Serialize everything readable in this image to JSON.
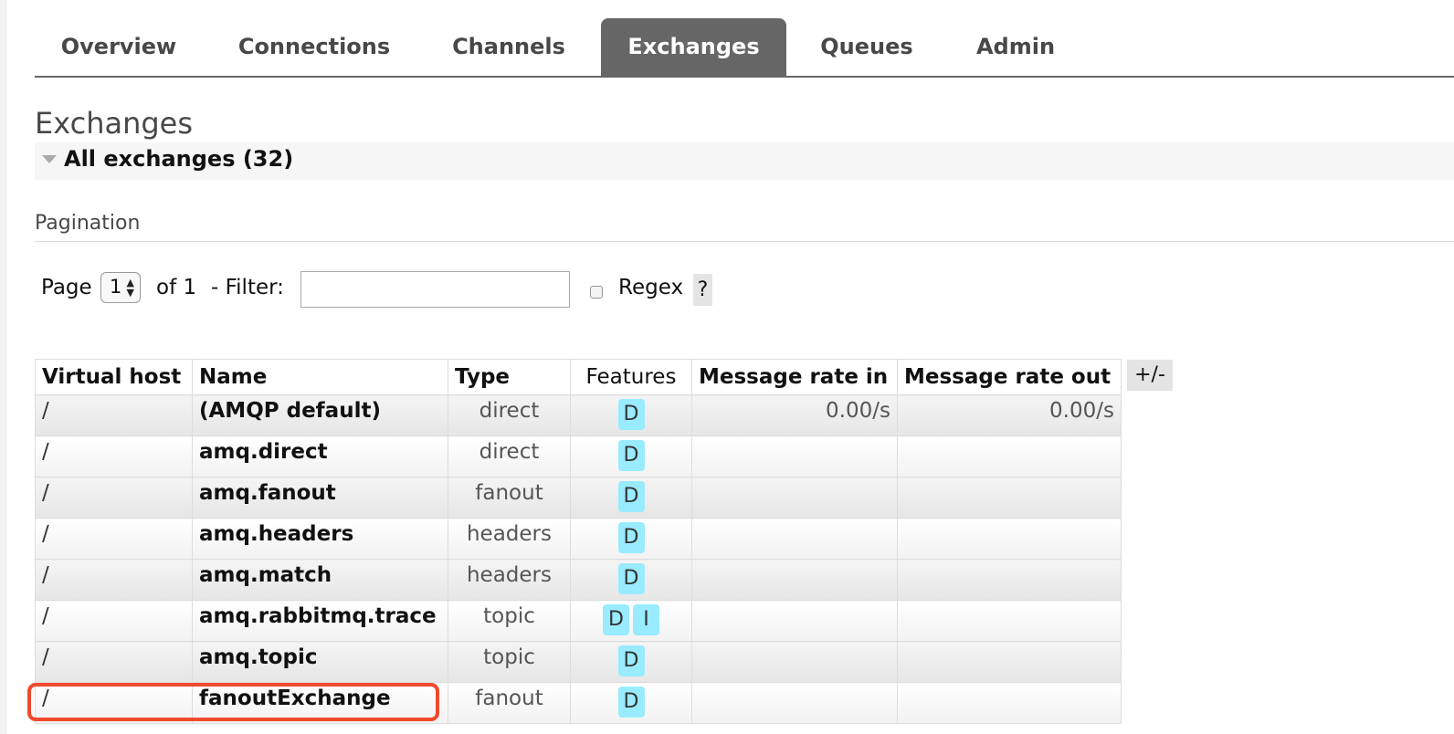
{
  "nav": {
    "tabs": [
      {
        "label": "Overview"
      },
      {
        "label": "Connections"
      },
      {
        "label": "Channels"
      },
      {
        "label": "Exchanges"
      },
      {
        "label": "Queues"
      },
      {
        "label": "Admin"
      }
    ],
    "active_tab": "Exchanges"
  },
  "page": {
    "title": "Exchanges",
    "section_title": "All exchanges (32)"
  },
  "pagination": {
    "heading": "Pagination",
    "page_label": "Page",
    "page_value": "1",
    "of_label": "of 1",
    "filter_label": "- Filter:",
    "filter_value": "",
    "regex_label": "Regex",
    "regex_checked": false,
    "help_label": "?"
  },
  "table": {
    "columns": [
      "Virtual host",
      "Name",
      "Type",
      "Features",
      "Message rate in",
      "Message rate out"
    ],
    "toggle_columns_label": "+/-",
    "rows": [
      {
        "vhost": "/",
        "name": "(AMQP default)",
        "type": "direct",
        "features": [
          "D"
        ],
        "rate_in": "0.00/s",
        "rate_out": "0.00/s"
      },
      {
        "vhost": "/",
        "name": "amq.direct",
        "type": "direct",
        "features": [
          "D"
        ],
        "rate_in": "",
        "rate_out": ""
      },
      {
        "vhost": "/",
        "name": "amq.fanout",
        "type": "fanout",
        "features": [
          "D"
        ],
        "rate_in": "",
        "rate_out": ""
      },
      {
        "vhost": "/",
        "name": "amq.headers",
        "type": "headers",
        "features": [
          "D"
        ],
        "rate_in": "",
        "rate_out": ""
      },
      {
        "vhost": "/",
        "name": "amq.match",
        "type": "headers",
        "features": [
          "D"
        ],
        "rate_in": "",
        "rate_out": ""
      },
      {
        "vhost": "/",
        "name": "amq.rabbitmq.trace",
        "type": "topic",
        "features": [
          "D",
          "I"
        ],
        "rate_in": "",
        "rate_out": ""
      },
      {
        "vhost": "/",
        "name": "amq.topic",
        "type": "topic",
        "features": [
          "D"
        ],
        "rate_in": "",
        "rate_out": ""
      },
      {
        "vhost": "/",
        "name": "fanoutExchange",
        "type": "fanout",
        "features": [
          "D"
        ],
        "rate_in": "",
        "rate_out": ""
      }
    ]
  },
  "colors": {
    "tab_active_bg": "#666666",
    "feature_badge_bg": "#99ebff",
    "highlight_border": "#f04a2c"
  }
}
